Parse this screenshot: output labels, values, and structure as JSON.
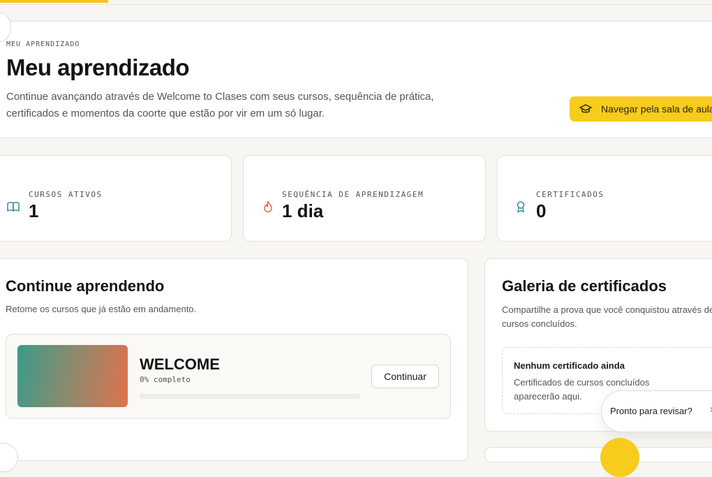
{
  "hero": {
    "eyebrow": "MEU APRENDIZADO",
    "title": "Meu aprendizado",
    "description": "Continue avançando através de Welcome to Clases com seus cursos, sequência de prática, certificados e momentos da coorte que estão por vir em um só lugar.",
    "browse_label": "Navegar pela sala de aula"
  },
  "stats": [
    {
      "label": "CURSOS ATIVOS",
      "value": "1",
      "icon": "book-icon",
      "color": "#2f8f9a"
    },
    {
      "label": "SEQUÊNCIA DE APRENDIZAGEM",
      "value": "1 dia",
      "icon": "flame-icon",
      "color": "#e2683e"
    },
    {
      "label": "CERTIFICADOS",
      "value": "0",
      "icon": "award-icon",
      "color": "#2f8f9a"
    }
  ],
  "continue_learning": {
    "title": "Continue aprendendo",
    "subtitle": "Retome os cursos que já estão em andamento.",
    "course": {
      "name": "WELCOME",
      "progress_text": "0% completo",
      "progress": 0,
      "button": "Continuar"
    }
  },
  "gallery": {
    "title": "Galeria de certificados",
    "subtitle": "Compartilhe a prova que você conquistou através de cursos concluídos.",
    "empty_title": "Nenhum certificado ainda",
    "empty_text": "Certificados de cursos concluídos aparecerão aqui."
  },
  "toast": {
    "text": "Pronto para revisar?",
    "close": "×"
  },
  "colors": {
    "accent": "#f5c518",
    "button": "#f7cc1c"
  }
}
